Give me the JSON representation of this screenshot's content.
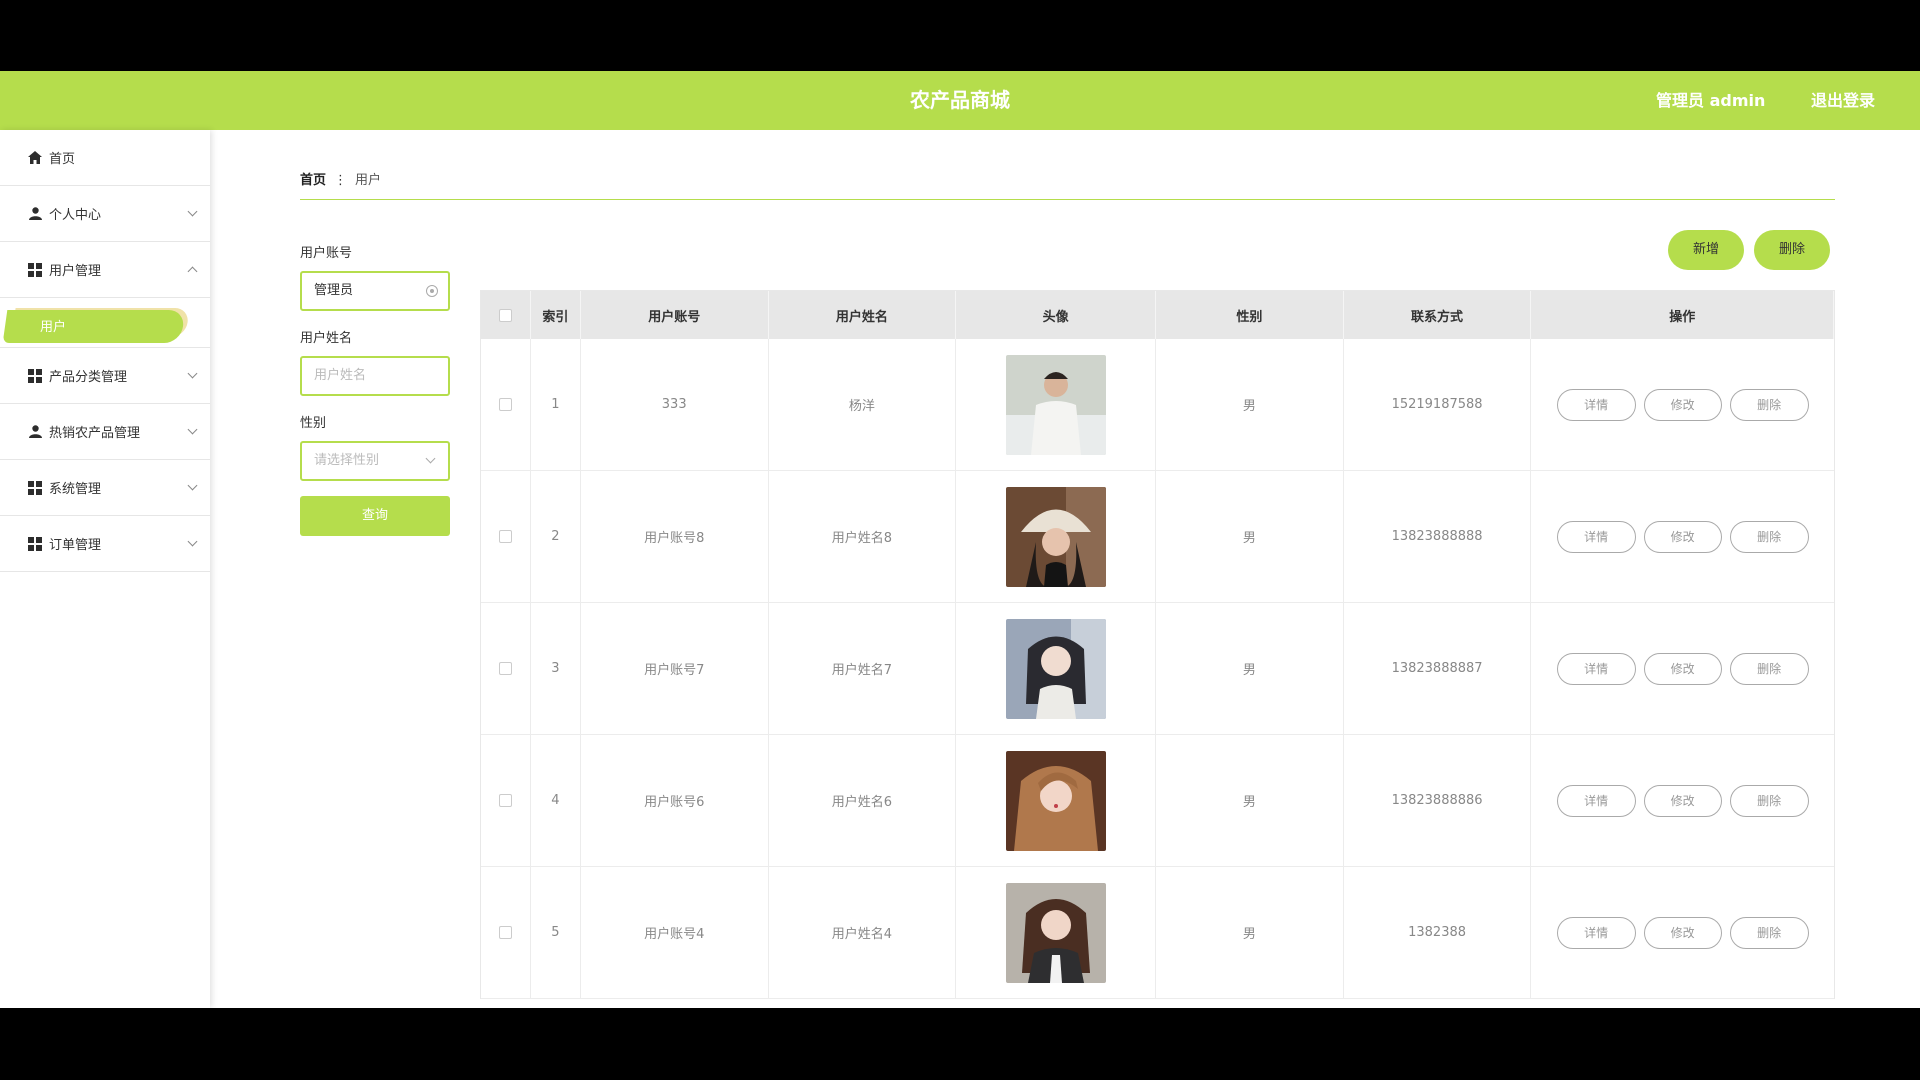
{
  "header": {
    "title": "农产品商城",
    "user": "管理员 admin",
    "logout": "退出登录"
  },
  "sidebar": {
    "items": [
      {
        "label": "首页",
        "icon": "home-icon"
      },
      {
        "label": "个人中心",
        "icon": "person-icon"
      },
      {
        "label": "用户管理",
        "icon": "grid-icon"
      },
      {
        "label": "产品分类管理",
        "icon": "grid-icon"
      },
      {
        "label": "热销农产品管理",
        "icon": "person-icon"
      },
      {
        "label": "系统管理",
        "icon": "grid-icon"
      },
      {
        "label": "订单管理",
        "icon": "grid-icon"
      }
    ],
    "active_sub": "用户"
  },
  "breadcrumb": {
    "home": "首页",
    "current": "用户"
  },
  "search": {
    "account_label": "用户账号",
    "account_value": "管理员",
    "name_label": "用户姓名",
    "name_placeholder": "用户姓名",
    "gender_label": "性别",
    "gender_placeholder": "请选择性别",
    "query": "查询"
  },
  "actions": {
    "add": "新增",
    "delete": "删除"
  },
  "table": {
    "columns": [
      "索引",
      "用户账号",
      "用户姓名",
      "头像",
      "性别",
      "联系方式",
      "操作"
    ],
    "rows": [
      {
        "index": "1",
        "account": "333",
        "name": "杨洋",
        "gender": "男",
        "phone": "15219187588"
      },
      {
        "index": "2",
        "account": "用户账号8",
        "name": "用户姓名8",
        "gender": "男",
        "phone": "13823888888"
      },
      {
        "index": "3",
        "account": "用户账号7",
        "name": "用户姓名7",
        "gender": "男",
        "phone": "13823888887"
      },
      {
        "index": "4",
        "account": "用户账号6",
        "name": "用户姓名6",
        "gender": "男",
        "phone": "13823888886"
      },
      {
        "index": "5",
        "account": "用户账号4",
        "name": "用户姓名4",
        "gender": "男",
        "phone": "1382388"
      }
    ],
    "row_buttons": {
      "detail": "详情",
      "edit": "修改",
      "delete": "删除"
    }
  },
  "colors": {
    "accent": "#b5dd4c",
    "header_bg": "#e7e7e7"
  }
}
